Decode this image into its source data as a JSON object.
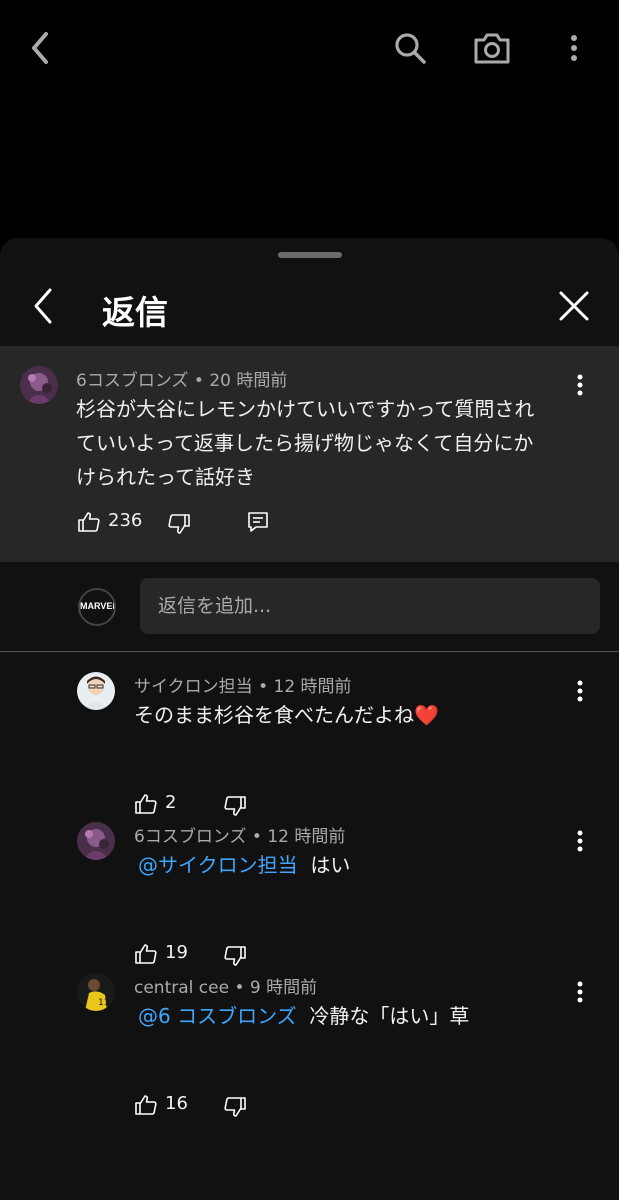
{
  "topbar": {
    "back_icon": "chevron-left-icon",
    "search_icon": "search-icon",
    "camera_icon": "camera-icon",
    "more_icon": "more-vertical-icon"
  },
  "sheet": {
    "title": "返信",
    "close_icon": "close-icon"
  },
  "original_comment": {
    "author": "6コスブロンズ",
    "time": "20 時間前",
    "text_lines": [
      "杉谷が大谷にレモンかけていいですかって質問され",
      "ていいよって返事したら揚げ物じゃなくて自分にか",
      "けられたって話好き"
    ],
    "likes": "236"
  },
  "add_reply": {
    "placeholder": "返信を追加...",
    "avatar_text": "MARVEL"
  },
  "replies": [
    {
      "author": "サイクロン担当",
      "time": "12 時間前",
      "mention": "",
      "text": "そのまま杉谷を食べたんだよね❤️",
      "likes": "2"
    },
    {
      "author": "6コスブロンズ",
      "time": "12 時間前",
      "mention": "@サイクロン担当",
      "text": "はい",
      "likes": "19"
    },
    {
      "author": "central cee",
      "time": "9 時間前",
      "mention": "@6 コスブロンズ",
      "text": "冷静な「はい」草",
      "likes": "16"
    }
  ],
  "colors": {
    "mention": "#3ea6ff",
    "sheet_bg": "#111111",
    "highlight_bg": "#272727"
  }
}
